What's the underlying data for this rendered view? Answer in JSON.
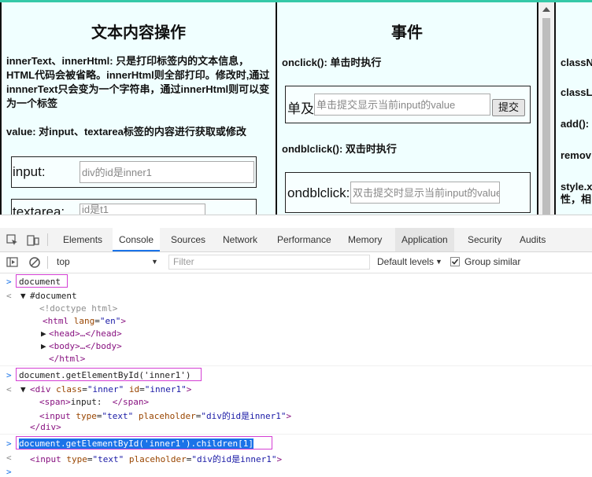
{
  "page": {
    "panel1": {
      "title": "文本内容操作",
      "para1": "innerText、innerHtml: 只是打印标签内的文本信息，HTML代码会被省略。innerHtml则全部打印。修改时,通过innnerText只会变为一个字符串，通过innerHtml则可以变为一个标签",
      "para2": "value: 对input、textarea标签的内容进行获取或修改",
      "input_label": "input:",
      "input_placeholder": "div的id是inner1",
      "partial_label": "textarea:",
      "partial_placeholder": "id是t1"
    },
    "panel2": {
      "title": "事件",
      "onclick_desc": "onclick(): 单击时执行",
      "single_label": "单及:",
      "single_placeholder": "单击提交显示当前input的value",
      "submit_label": "提交",
      "dbl_desc": "ondblclick(): 双击时执行",
      "dbl_label": "ondblclick:",
      "dbl_placeholder": "双击提交时显示当前input的value"
    },
    "panel3": {
      "items": [
        "classN",
        "classLi",
        "add():",
        "remov",
        "style.x",
        "性，相"
      ]
    }
  },
  "devtools": {
    "tabs": [
      "Elements",
      "Console",
      "Sources",
      "Network",
      "Performance",
      "Memory",
      "Application",
      "Security",
      "Audits"
    ],
    "active_tab": "Console",
    "context": "top",
    "filter_placeholder": "Filter",
    "levels": "Default levels",
    "group_similar": "Group similar"
  },
  "console": {
    "cmd1": "document",
    "doc_root": "#document",
    "doctype": "<!doctype html>",
    "html_open_tag": "html",
    "html_attr": "lang",
    "html_val": "\"en\"",
    "head": "<head>…</head>",
    "body": "<body>…</body>",
    "html_close": "</html>",
    "cmd2": "document.getElementById('inner1')",
    "div_tag": "div",
    "div_class_attr": "class",
    "div_class_val": "\"inner\"",
    "div_id_attr": "id",
    "div_id_val": "\"inner1\"",
    "span_open": "<span>",
    "span_text": "input:  ",
    "span_close": "</span>",
    "input_tag": "input",
    "type_attr": "type",
    "type_val": "\"text\"",
    "ph_attr": "placeholder",
    "ph_val": "\"div的id是inner1\"",
    "div_close": "</div>",
    "cmd3": "document.getElementById('inner1').children[1]"
  }
}
